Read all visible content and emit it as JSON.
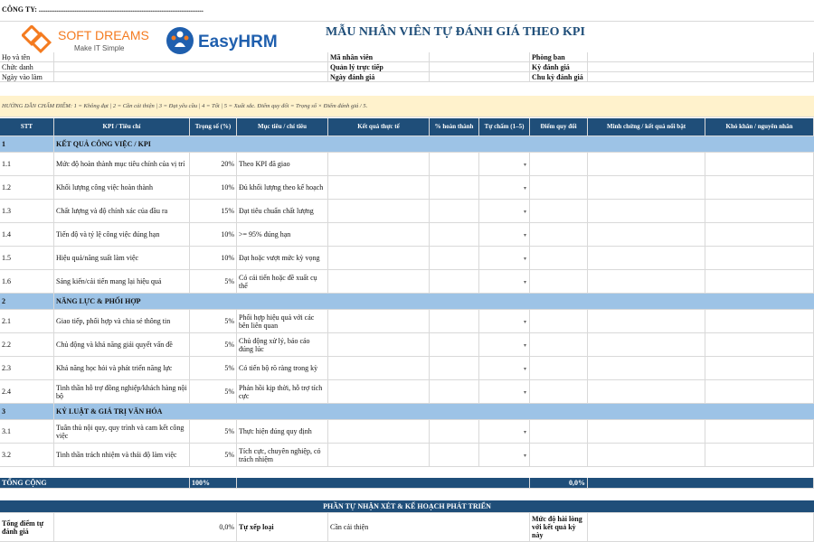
{
  "company_label": "CÔNG TY: ...........................................................................................",
  "brand": {
    "softdreams_name": "SOFT DREAMS",
    "softdreams_tagline": "Make IT Simple",
    "easyhrm_name": "EasyHRM"
  },
  "title": "MẪU NHÂN VIÊN TỰ ĐÁNH GIÁ THEO KPI",
  "info": {
    "full_name": "Họ và tên",
    "position": "Chức danh",
    "start_date": "Ngày vào làm",
    "employee_id": "Mã nhân viên",
    "manager": "Quản lý trực tiếp",
    "eval_date": "Ngày đánh giá",
    "department": "Phòng ban",
    "period": "Kỳ đánh giá",
    "cycle": "Chu kỳ đánh giá"
  },
  "guide": "HƯỚNG DẪN CHẤM ĐIỂM: 1 = Không đạt | 2 = Cần cải thiện | 3 = Đạt yêu cầu | 4 = Tốt | 5 = Xuất sắc. Điểm quy đổi = Trọng số × Điểm đánh giá / 5.",
  "columns": [
    "STT",
    "KPI / Tiêu chí",
    "Trọng số (%)",
    "Mục tiêu / chỉ tiêu",
    "Kết quả thực tế",
    "% hoàn thành",
    "Tự chấm (1–5)",
    "Điểm quy đổi",
    "Minh chứng / kết quả nổi bật",
    "Khó khăn / nguyên nhân"
  ],
  "sections": [
    {
      "no": "1",
      "name": "KẾT QUẢ CÔNG VIỆC / KPI",
      "rows": [
        {
          "no": "1.1",
          "kpi": "Mức độ hoàn thành mục tiêu chính của vị trí",
          "weight": "20%",
          "target": "Theo KPI đã giao"
        },
        {
          "no": "1.2",
          "kpi": "Khối lượng công việc hoàn thành",
          "weight": "10%",
          "target": "Đủ khối lượng theo kế hoạch"
        },
        {
          "no": "1.3",
          "kpi": "Chất lượng và độ chính xác của đầu ra",
          "weight": "15%",
          "target": "Đạt tiêu chuẩn chất lượng"
        },
        {
          "no": "1.4",
          "kpi": "Tiến độ và tỷ lệ công việc đúng hạn",
          "weight": "10%",
          "target": ">= 95% đúng hạn"
        },
        {
          "no": "1.5",
          "kpi": "Hiệu quả/năng suất làm việc",
          "weight": "10%",
          "target": "Đạt hoặc vượt mức kỳ vọng"
        },
        {
          "no": "1.6",
          "kpi": "Sáng kiến/cải tiến mang lại hiệu quả",
          "weight": "5%",
          "target": "Có cải tiến hoặc đề xuất cụ thể"
        }
      ]
    },
    {
      "no": "2",
      "name": "NĂNG LỰC & PHỐI HỢP",
      "rows": [
        {
          "no": "2.1",
          "kpi": "Giao tiếp, phối hợp và chia sẻ thông tin",
          "weight": "5%",
          "target": "Phối hợp hiệu quả với các bên liên quan"
        },
        {
          "no": "2.2",
          "kpi": "Chủ động và khả năng giải quyết vấn đề",
          "weight": "5%",
          "target": "Chủ động xử lý, báo cáo đúng lúc"
        },
        {
          "no": "2.3",
          "kpi": "Khả năng học hỏi và phát triển năng lực",
          "weight": "5%",
          "target": "Có tiến bộ rõ ràng trong kỳ"
        },
        {
          "no": "2.4",
          "kpi": "Tinh thần hỗ trợ đồng nghiệp/khách hàng nội bộ",
          "weight": "5%",
          "target": "Phản hồi kịp thời, hỗ trợ tích cực"
        }
      ]
    },
    {
      "no": "3",
      "name": "KỶ LUẬT & GIÁ TRỊ VĂN HÓA",
      "rows": [
        {
          "no": "3.1",
          "kpi": "Tuân thủ nội quy, quy trình và cam kết công việc",
          "weight": "5%",
          "target": "Thực hiện đúng quy định"
        },
        {
          "no": "3.2",
          "kpi": "Tinh thần trách nhiệm và thái độ làm việc",
          "weight": "5%",
          "target": "Tích cực, chuyên nghiệp, có trách nhiệm"
        }
      ]
    }
  ],
  "total": {
    "label": "TỔNG CỘNG",
    "weight": "100%",
    "score": "0,0%"
  },
  "review": {
    "header": "PHẦN TỰ NHẬN XÉT & KẾ HOẠCH PHÁT TRIỂN",
    "total_score_label": "Tổng điểm tự đánh giá",
    "total_score_value": "0,0%",
    "self_rank_label": "Tự xếp loại",
    "improve_label": "Cần cải thiện",
    "satisfaction_label": "Mức độ hài lòng với kết quả kỳ này"
  },
  "colors": {
    "header_bg": "#1f4e79",
    "section_bg": "#9dc3e6",
    "guide_bg": "#fff2cc",
    "brand_orange": "#f47b20",
    "brand_blue": "#1f5fae"
  }
}
